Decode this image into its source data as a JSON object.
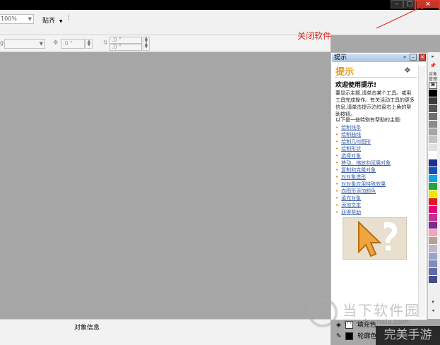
{
  "window": {
    "close_glyph": "×",
    "min_glyph": "–",
    "max_glyph": "□"
  },
  "toolbar": {
    "zoom_value": "100%",
    "snap_label": "贴齐",
    "x_value": ".0 \"",
    "y_value": ".0 \"",
    "w_value": ".0 \""
  },
  "annotation": {
    "label": "关闭软件",
    "color": "#d9271c"
  },
  "statusbar": {
    "object_info": "对象信息"
  },
  "docker": {
    "title": "提示",
    "header": "提示",
    "welcome": "欢迎使用提示!",
    "intro": "要显示主题,请单击某个工具。或用工具完成操作。有关活动工具的更多信息,请单击提示泊坞窗右上角的帮助按钮。",
    "list_intro": "以下是一些特别有帮助的主题:",
    "topics": [
      "绘制线条",
      "绘制曲线",
      "绘制几何图形",
      "绘制形状",
      "选择对象",
      "移动、缩放和延展对象",
      "复制和克隆对象",
      "对对象造形",
      "对对象应用特殊效果",
      "向图形添加颜色",
      "填充对象",
      "添加文本",
      "获得帮助"
    ]
  },
  "tabs": {
    "object_manager": "对象管理器",
    "hints": "提示"
  },
  "palette": {
    "colors": [
      "#000000",
      "#3a3a3a",
      "#555555",
      "#707070",
      "#8a8a8a",
      "#a5a5a5",
      "#c3c3c3",
      "#e0e0e0",
      "#ffffff",
      "#1d2f8f",
      "#0b55b8",
      "#14a5dc",
      "#23a53c",
      "#f2e300",
      "#e31a21",
      "#e6007e",
      "#c22f90",
      "#7b2a8e",
      "#f5a3b5",
      "#b6a19a",
      "#c6b2c8",
      "#9aa3c7",
      "#7f8bb9",
      "#5e6aa7",
      "#444d8c"
    ]
  },
  "fill": {
    "label": "填充色",
    "color": "#ffffff"
  },
  "outline": {
    "label": "轮廓色",
    "color": "#000000"
  },
  "watermark": {
    "text": "当下软件园",
    "url": "www.downxia.com",
    "corner": "完美手游"
  }
}
